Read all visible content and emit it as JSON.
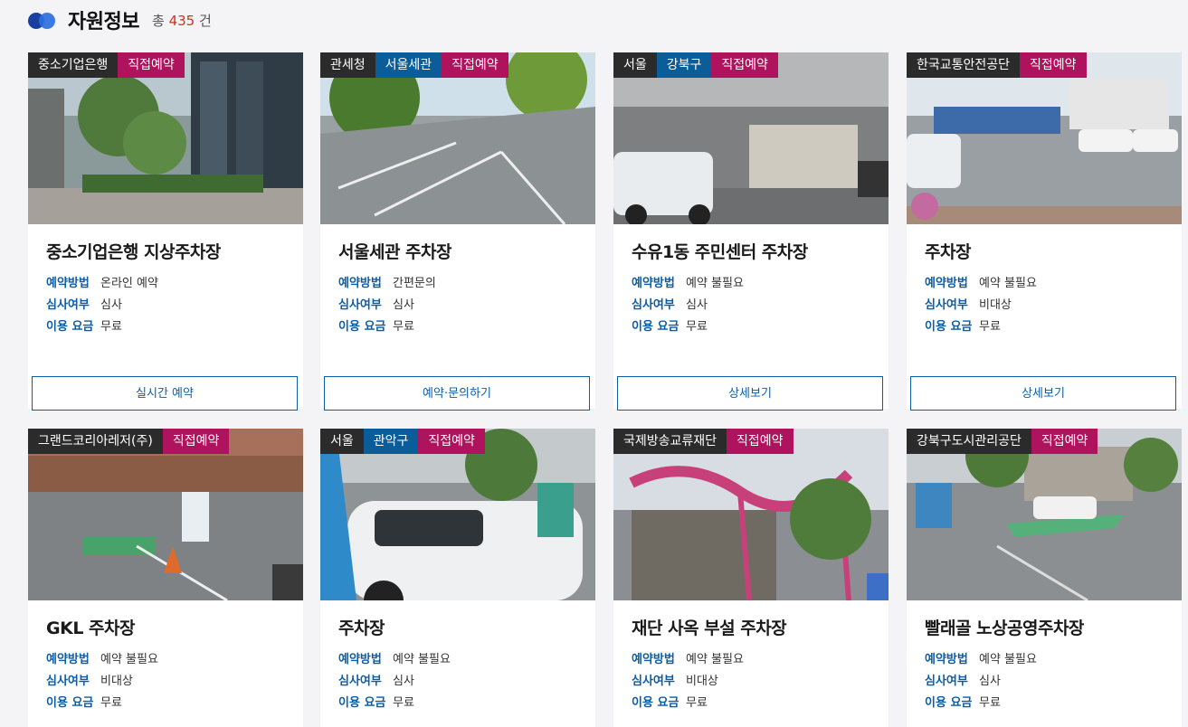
{
  "header": {
    "title": "자원정보",
    "count_prefix": "총",
    "count": "435",
    "count_suffix": "건"
  },
  "labels": {
    "method": "예약방법",
    "review": "심사여부",
    "fee": "이용 요금"
  },
  "cards": [
    {
      "tags": [
        "중소기업은행",
        "직접예약"
      ],
      "name": "중소기업은행 지상주차장",
      "method": "온라인 예약",
      "review": "심사",
      "fee": "무료",
      "button": "실시간 예약"
    },
    {
      "tags": [
        "관세청",
        "서울세관",
        "직접예약"
      ],
      "name": "서울세관 주차장",
      "method": "간편문의",
      "review": "심사",
      "fee": "무료",
      "button": "예약·문의하기"
    },
    {
      "tags": [
        "서울",
        "강북구",
        "직접예약"
      ],
      "name": "수유1동 주민센터 주차장",
      "method": "예약 불필요",
      "review": "심사",
      "fee": "무료",
      "button": "상세보기"
    },
    {
      "tags": [
        "한국교통안전공단",
        "직접예약"
      ],
      "name": "주차장",
      "method": "예약 불필요",
      "review": "비대상",
      "fee": "무료",
      "button": "상세보기"
    },
    {
      "tags": [
        "그랜드코리아레저(주)",
        "직접예약"
      ],
      "name": "GKL 주차장",
      "method": "예약 불필요",
      "review": "비대상",
      "fee": "무료"
    },
    {
      "tags": [
        "서울",
        "관악구",
        "직접예약"
      ],
      "name": "주차장",
      "method": "예약 불필요",
      "review": "심사",
      "fee": "무료"
    },
    {
      "tags": [
        "국제방송교류재단",
        "직접예약"
      ],
      "name": "재단 사옥 부설 주차장",
      "method": "예약 불필요",
      "review": "비대상",
      "fee": "무료"
    },
    {
      "tags": [
        "강북구도시관리공단",
        "직접예약"
      ],
      "name": "빨래골 노상공영주차장",
      "method": "예약 불필요",
      "review": "심사",
      "fee": "무료"
    }
  ],
  "colors": {
    "accent_blue": "#0d5da6",
    "tag_dark": "#2b2b2b",
    "tag_blue": "#0b5d9a",
    "tag_magenta": "#b0135e",
    "count_red": "#d2301f"
  }
}
